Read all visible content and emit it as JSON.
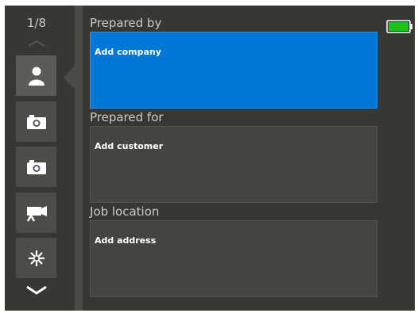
{
  "sidebar": {
    "page_indicator": "1/8",
    "items": [
      {
        "icon": "person-icon",
        "active": true
      },
      {
        "icon": "camera-icon",
        "active": false
      },
      {
        "icon": "camera-icon",
        "active": false
      },
      {
        "icon": "video-camera-icon",
        "active": false
      },
      {
        "icon": "asterisk-icon",
        "active": false
      }
    ]
  },
  "sections": [
    {
      "label": "Prepared by",
      "value": "Add company"
    },
    {
      "label": "Prepared for",
      "value": "Add customer"
    },
    {
      "label": "Job location",
      "value": "Add address"
    }
  ],
  "status": {
    "battery_icon": "battery-icon",
    "battery_level": 1.0
  },
  "colors": {
    "selected_field": "#0077d9",
    "field": "#434640",
    "battery": "#19c419",
    "background": "#363834"
  }
}
